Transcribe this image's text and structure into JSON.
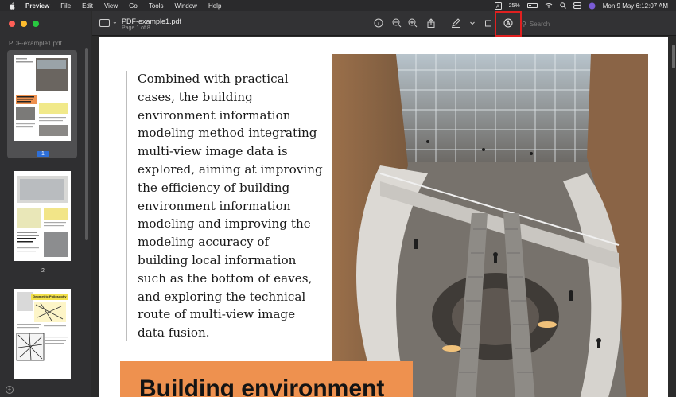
{
  "menubar": {
    "app_name": "Preview",
    "items": [
      "File",
      "Edit",
      "View",
      "Go",
      "Tools",
      "Window",
      "Help"
    ],
    "battery_percent": "25%",
    "datetime": "Mon 9 May  6:12:07 AM"
  },
  "sidebar": {
    "file_name": "PDF-example1.pdf",
    "pages": [
      {
        "number": "1",
        "selected": true
      },
      {
        "number": "2",
        "selected": false
      }
    ],
    "page3_title": "Geometric Philosophy"
  },
  "toolbar": {
    "title": "PDF-example1.pdf",
    "subtitle": "Page 1 of 8",
    "search_placeholder": "Search",
    "icons": [
      "sidebar-icon",
      "info-icon",
      "zoom-out-icon",
      "zoom-in-icon",
      "share-icon",
      "pen-icon",
      "chevron-down-icon",
      "crop-icon",
      "markup-icon",
      "search-icon"
    ]
  },
  "page": {
    "body_lines": [
      "Combined with practical",
      "cases, the building",
      "environment information",
      "modeling method integrating",
      "multi-view image data is",
      "explored, aiming at improving",
      "the efficiency of building",
      "environment information",
      "modeling and improving the",
      "modeling accuracy of",
      "building local information",
      "such as the bottom of eaves,",
      "and exploring the technical",
      "route of multi-view image",
      "data fusion."
    ],
    "headline": "Building environment"
  },
  "colors": {
    "accent_orange": "#ee914f",
    "highlight_red": "#e02020",
    "selection_blue": "#2e6fd8"
  }
}
